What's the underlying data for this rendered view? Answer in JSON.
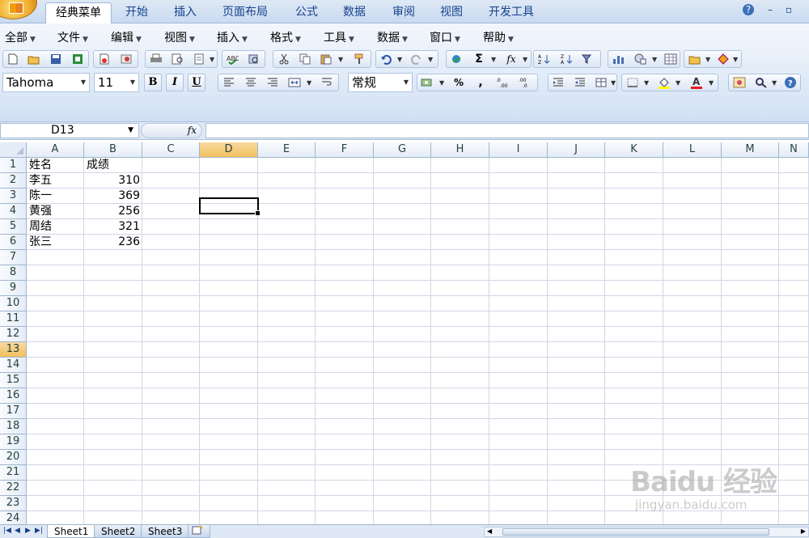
{
  "ribbon_tabs": [
    "经典菜单",
    "开始",
    "插入",
    "页面布局",
    "公式",
    "数据",
    "审阅",
    "视图",
    "开发工具"
  ],
  "window_controls": [
    "?",
    "–",
    "▫"
  ],
  "classic_menu": [
    "全部",
    "文件",
    "编辑",
    "视图",
    "插入",
    "格式",
    "工具",
    "数据",
    "窗口",
    "帮助"
  ],
  "font": {
    "name": "Tahoma",
    "size": "11"
  },
  "format": {
    "bold": "B",
    "italic": "I",
    "underline": "U",
    "number_format": "常规",
    "percent": "%",
    "comma": ","
  },
  "formula_bar": {
    "name_box": "D13",
    "fx_label": "fx",
    "formula": ""
  },
  "columns": [
    "A",
    "B",
    "C",
    "D",
    "E",
    "F",
    "G",
    "H",
    "I",
    "J",
    "K",
    "L",
    "M",
    "N"
  ],
  "rows": [
    "1",
    "2",
    "3",
    "4",
    "5",
    "6",
    "7",
    "8",
    "9",
    "10",
    "11",
    "12",
    "13",
    "14",
    "15",
    "16",
    "17",
    "18",
    "19",
    "20",
    "21",
    "22",
    "23",
    "24"
  ],
  "selected": {
    "column": "D",
    "row": "13"
  },
  "cells": {
    "header": [
      "姓名",
      "成绩"
    ],
    "data": [
      [
        "李五",
        "310"
      ],
      [
        "陈一",
        "369"
      ],
      [
        "黄强",
        "256"
      ],
      [
        "周结",
        "321"
      ],
      [
        "张三",
        "236"
      ]
    ]
  },
  "sheets": [
    "Sheet1",
    "Sheet2",
    "Sheet3"
  ],
  "watermark": {
    "logo": "Baidu 经验",
    "url": "jingyan.baidu.com"
  },
  "colors": {
    "accent": "#15428b",
    "selected_header": "#f1c15f",
    "grid_line": "#d0d7e5"
  }
}
